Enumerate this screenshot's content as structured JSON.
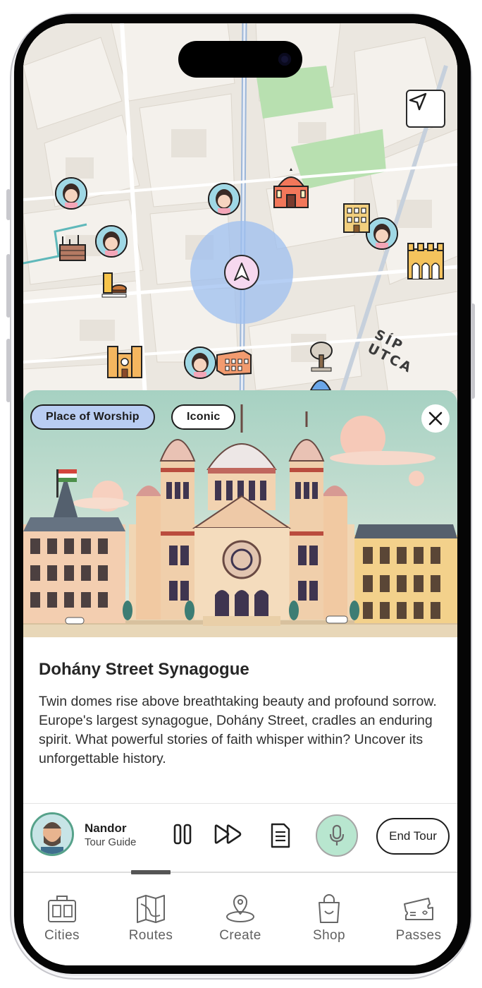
{
  "map": {
    "street_label": "SÍP UTCA"
  },
  "card": {
    "tags": [
      "Place of Worship",
      "Iconic"
    ],
    "title": "Dohány Street Synagogue",
    "description": "Twin domes rise above breathtaking beauty and profound sorrow. Europe's largest synagogue, Dohány Street, cradles an enduring spirit. What powerful stories of faith whisper within? Uncover its unforgettable history."
  },
  "player": {
    "guide_name": "Nandor",
    "guide_role": "Tour Guide",
    "end_label": "End Tour"
  },
  "tabs": [
    "Cities",
    "Routes",
    "Create",
    "Shop",
    "Passes"
  ],
  "colors": {
    "tag_primary": "#b9cdf2",
    "mic": "#b8e6cf",
    "guide_ring": "#56a28a",
    "location_halo": "#9ebff0"
  }
}
